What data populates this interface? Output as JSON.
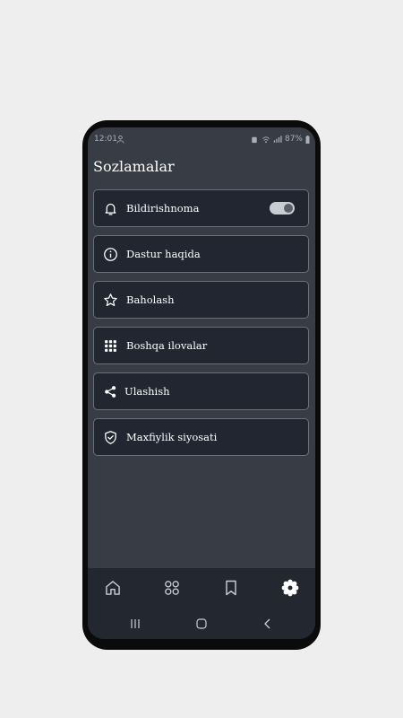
{
  "status_bar": {
    "time": "12:01",
    "battery": "87%",
    "icons": [
      "person-icon",
      "alarm-icon",
      "wifi-icon",
      "signal-icon",
      "battery-icon"
    ]
  },
  "header": {
    "title": "Sozlamalar"
  },
  "settings": {
    "items": [
      {
        "label": "Bildirishnoma",
        "icon": "bell-icon",
        "toggle_on": true
      },
      {
        "label": "Dastur haqida",
        "icon": "info-icon"
      },
      {
        "label": "Baholash",
        "icon": "star-icon"
      },
      {
        "label": "Boshqa ilovalar",
        "icon": "apps-grid-icon"
      },
      {
        "label": "Ulashish",
        "icon": "share-icon"
      },
      {
        "label": "Maxfiylik siyosati",
        "icon": "shield-check-icon"
      }
    ]
  },
  "bottom_nav": {
    "items": [
      {
        "icon": "home-icon",
        "active": false
      },
      {
        "icon": "categories-icon",
        "active": false
      },
      {
        "icon": "bookmark-icon",
        "active": false
      },
      {
        "icon": "settings-gear-icon",
        "active": true
      }
    ]
  },
  "system_nav": {
    "icons": [
      "recents-icon",
      "home-circle-icon",
      "back-icon"
    ]
  },
  "colors": {
    "page_background": "#eeeeee",
    "screen_background": "#383c44",
    "card_background": "#212630",
    "card_border": "#6a7078",
    "nav_background": "#232830",
    "text": "#ffffff"
  }
}
